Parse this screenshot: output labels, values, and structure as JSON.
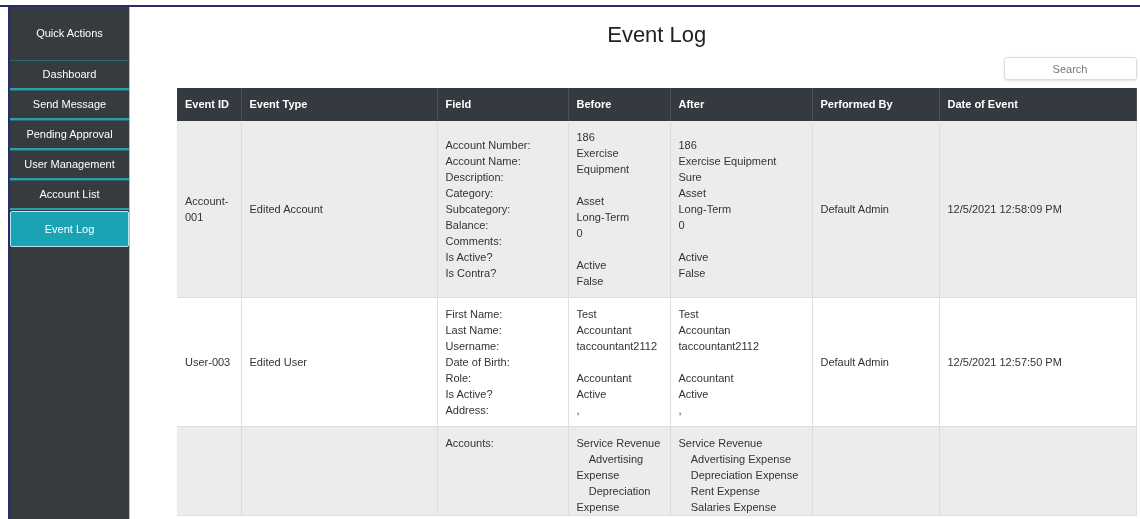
{
  "sidebar": {
    "title": "Quick Actions",
    "items": [
      {
        "label": "Dashboard",
        "selected": false
      },
      {
        "label": "Send Message",
        "selected": false
      },
      {
        "label": "Pending Approval",
        "selected": false
      },
      {
        "label": "User Management",
        "selected": false
      },
      {
        "label": "Account List",
        "selected": false
      },
      {
        "label": "Event Log",
        "selected": true
      }
    ]
  },
  "page_title": "Event Log",
  "search": {
    "placeholder": "Search"
  },
  "table": {
    "columns": [
      "Event ID",
      "Event Type",
      "Field",
      "Before",
      "After",
      "Performed By",
      "Date of Event"
    ],
    "rows": [
      [
        "Account-001",
        "Edited Account",
        "Account Number:\nAccount Name:\nDescription:\nCategory:\nSubcategory:\nBalance:\nComments:\nIs Active?\nIs Contra?",
        "186\nExercise Equipment\n\nAsset\nLong-Term\n0\n\nActive\nFalse",
        "186\nExercise Equipment\nSure\nAsset\nLong-Term\n0\n\nActive\nFalse",
        "Default Admin",
        "12/5/2021 12:58:09 PM"
      ],
      [
        "User-003",
        "Edited User",
        "First Name:\nLast Name:\nUsername:\nDate of Birth:\nRole:\nIs Active?\nAddress:",
        "Test\nAccountant\ntaccountant2112\n\nAccountant\nActive\n,",
        "Test\nAccountan\ntaccountant2112\n\nAccountant\nActive\n,",
        "Default Admin",
        "12/5/2021 12:57:50 PM"
      ],
      [
        "",
        "",
        "Accounts:",
        "Service Revenue\n    Advertising Expense\n    Depreciation Expense",
        "Service Revenue\n    Advertising Expense\n    Depreciation Expense\n    Rent Expense\n    Salaries Expense",
        "",
        ""
      ]
    ]
  }
}
